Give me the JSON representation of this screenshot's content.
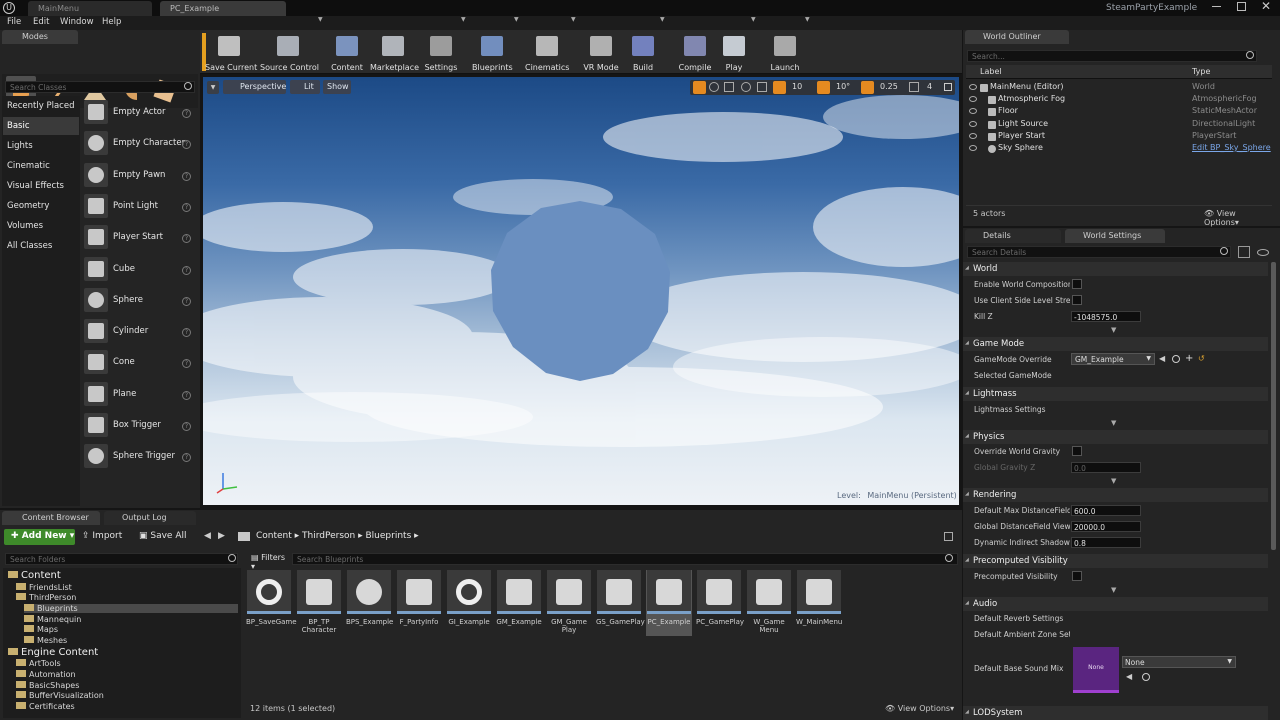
{
  "window": {
    "tabs": [
      "MainMenu",
      "PC_Example"
    ],
    "project": "SteamPartyExample"
  },
  "menu": [
    "File",
    "Edit",
    "Window",
    "Help"
  ],
  "modes": {
    "title": "Modes",
    "search_placeholder": "Search Classes",
    "categories": [
      "Recently Placed",
      "Basic",
      "Lights",
      "Cinematic",
      "Visual Effects",
      "Geometry",
      "Volumes",
      "All Classes"
    ],
    "items": [
      "Empty Actor",
      "Empty Character",
      "Empty Pawn",
      "Point Light",
      "Player Start",
      "Cube",
      "Sphere",
      "Cylinder",
      "Cone",
      "Plane",
      "Box Trigger",
      "Sphere Trigger"
    ]
  },
  "toolbar": [
    "Save Current",
    "Source Control",
    "Content",
    "Marketplace",
    "Settings",
    "Blueprints",
    "Cinematics",
    "VR Mode",
    "Build",
    "Compile",
    "Play",
    "Launch"
  ],
  "viewport": {
    "perspective": "Perspective",
    "lit": "Lit",
    "show": "Show",
    "grid": "10",
    "angle": "10°",
    "scale": "0.25",
    "cam": "4",
    "level_label": "Level:",
    "level_name": "MainMenu (Persistent)"
  },
  "outliner": {
    "title": "World Outliner",
    "search_placeholder": "Search...",
    "col_label": "Label",
    "col_type": "Type",
    "rows": [
      {
        "name": "MainMenu (Editor)",
        "type": "World"
      },
      {
        "name": "Atmospheric Fog",
        "type": "AtmosphericFog"
      },
      {
        "name": "Floor",
        "type": "StaticMeshActor"
      },
      {
        "name": "Light Source",
        "type": "DirectionalLight"
      },
      {
        "name": "Player Start",
        "type": "PlayerStart"
      },
      {
        "name": "Sky Sphere",
        "type": "Edit BP_Sky_Sphere"
      }
    ],
    "count": "5 actors",
    "view_options": "View Options"
  },
  "details": {
    "tabs": [
      "Details",
      "World Settings"
    ],
    "search_placeholder": "Search Details",
    "sections": {
      "world": "World",
      "gamemode": "Game Mode",
      "lightmass": "Lightmass",
      "physics": "Physics",
      "rendering": "Rendering",
      "precomputed": "Precomputed Visibility",
      "audio": "Audio",
      "lod": "LODSystem"
    },
    "props": {
      "enable_world_composition": "Enable World Composition",
      "client_side_streaming": "Use Client Side Level Streaming",
      "kill_z": "Kill Z",
      "kill_z_value": "-1048575.0",
      "gamemode_override": "GameMode Override",
      "gamemode_value": "GM_Example",
      "selected_gamemode": "Selected GameMode",
      "lightmass_settings": "Lightmass Settings",
      "override_gravity": "Override World Gravity",
      "global_gravity": "Global Gravity Z",
      "global_gravity_value": "0.0",
      "max_distance_field": "Default Max DistanceField Occlusion Distance",
      "max_distance_field_value": "600.0",
      "global_distance_field": "Global DistanceField View Distance",
      "global_distance_field_value": "20000.0",
      "indirect_shadows": "Dynamic Indirect Shadows Self Shadowing Intensity",
      "indirect_shadows_value": "0.8",
      "precomputed_visibility": "Precomputed Visibility",
      "reverb": "Default Reverb Settings",
      "ambient_zone": "Default Ambient Zone Settings",
      "base_sound_mix": "Default Base Sound Mix",
      "sound_mix_value": "None",
      "sound_mix_thumb": "None"
    }
  },
  "bottom_tabs": [
    "Content Browser",
    "Output Log"
  ],
  "content_browser": {
    "add_new": "Add New",
    "import": "Import",
    "save_all": "Save All",
    "path": [
      "Content",
      "ThirdPerson",
      "Blueprints"
    ],
    "folder_search": "Search Folders",
    "filters": "Filters",
    "asset_search": "Search Blueprints",
    "tree": [
      {
        "name": "Content",
        "level": 0,
        "big": true
      },
      {
        "name": "FriendsList",
        "level": 1
      },
      {
        "name": "ThirdPerson",
        "level": 1
      },
      {
        "name": "Blueprints",
        "level": 2,
        "selected": true
      },
      {
        "name": "Mannequin",
        "level": 2
      },
      {
        "name": "Maps",
        "level": 2
      },
      {
        "name": "Meshes",
        "level": 2
      },
      {
        "name": "Engine Content",
        "level": 0,
        "big": true
      },
      {
        "name": "ArtTools",
        "level": 1
      },
      {
        "name": "Automation",
        "level": 1
      },
      {
        "name": "BasicShapes",
        "level": 1
      },
      {
        "name": "BufferVisualization",
        "level": 1
      },
      {
        "name": "Certificates",
        "level": 1
      }
    ],
    "assets": [
      "BP_SaveGame",
      "BP_TP Character",
      "BPS_Example",
      "F_PartyInfo",
      "GI_Example",
      "GM_Example",
      "GM_Game Play",
      "GS_GamePlay",
      "PC_Example",
      "PC_GamePlay",
      "W_Game Menu",
      "W_MainMenu"
    ],
    "status": "12 items (1 selected)",
    "view_options": "View Options"
  },
  "colors": {
    "accent": "#4d7ab8",
    "add_new": "#3e8a2a",
    "sky_top": "#2a5a9a"
  }
}
